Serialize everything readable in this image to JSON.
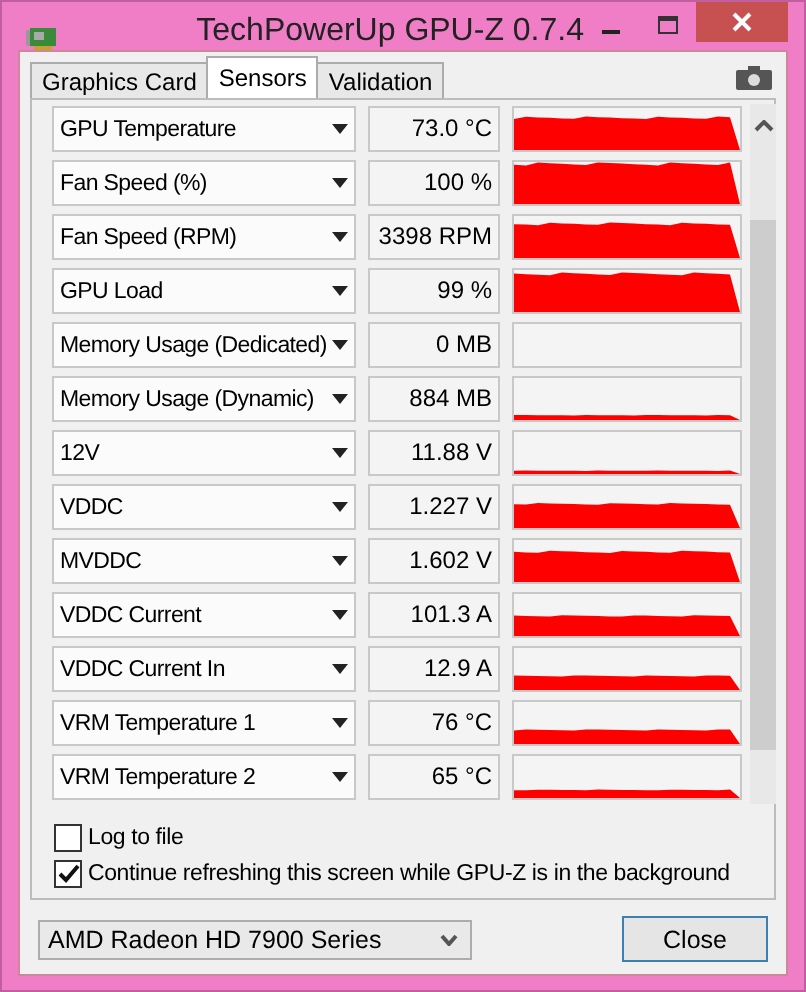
{
  "window": {
    "title": "TechPowerUp GPU-Z 0.7.4"
  },
  "tabs": [
    {
      "label": "Graphics Card",
      "selected": false
    },
    {
      "label": "Sensors",
      "selected": true
    },
    {
      "label": "Validation",
      "selected": false
    }
  ],
  "sensors": [
    {
      "name": "GPU Temperature",
      "value": "73.0 °C"
    },
    {
      "name": "Fan Speed (%)",
      "value": "100 %"
    },
    {
      "name": "Fan Speed (RPM)",
      "value": "3398 RPM"
    },
    {
      "name": "GPU Load",
      "value": "99 %"
    },
    {
      "name": "Memory Usage (Dedicated)",
      "value": "0 MB"
    },
    {
      "name": "Memory Usage (Dynamic)",
      "value": "884 MB"
    },
    {
      "name": "12V",
      "value": "11.88 V"
    },
    {
      "name": "VDDC",
      "value": "1.227 V"
    },
    {
      "name": "MVDDC",
      "value": "1.602 V"
    },
    {
      "name": "VDDC Current",
      "value": "101.3 A"
    },
    {
      "name": "VDDC Current In",
      "value": "12.9 A"
    },
    {
      "name": "VRM Temperature 1",
      "value": "76 °C"
    },
    {
      "name": "VRM Temperature 2",
      "value": "65 °C"
    }
  ],
  "options": [
    {
      "label": "Log to file",
      "checked": false
    },
    {
      "label": "Continue refreshing this screen while GPU-Z is in the background",
      "checked": true
    }
  ],
  "device": {
    "value": "AMD Radeon HD 7900 Series"
  },
  "buttons": [
    "Close"
  ]
}
